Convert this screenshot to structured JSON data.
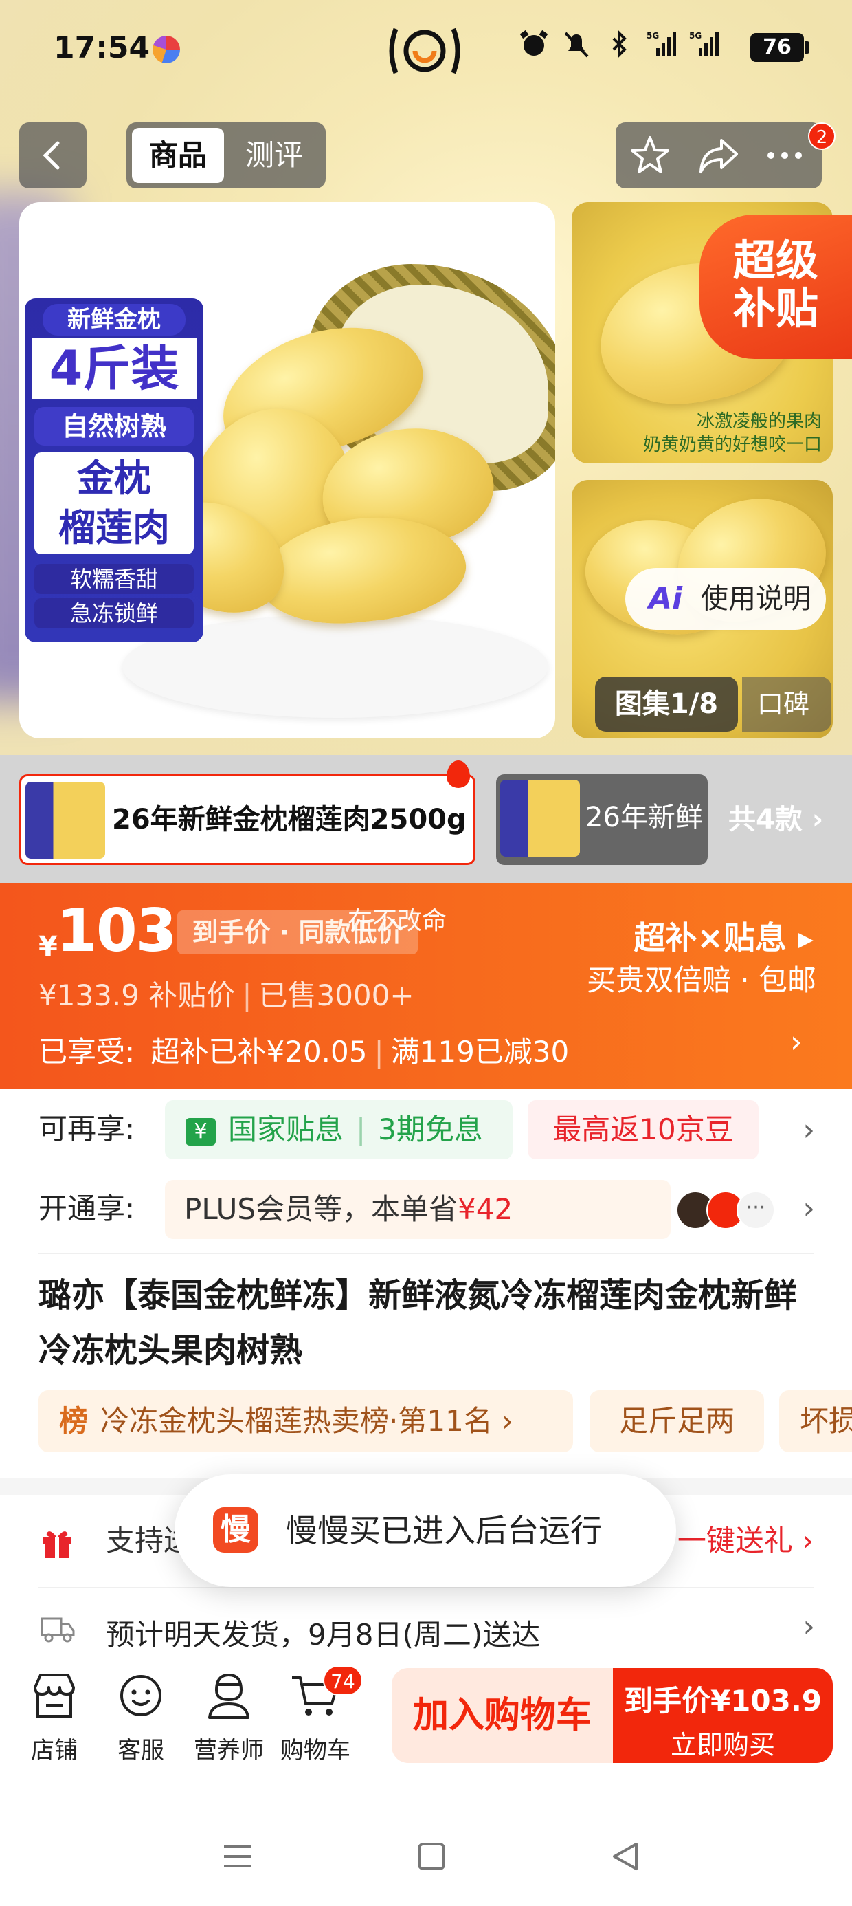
{
  "status_bar": {
    "time": "17:54",
    "battery": "76"
  },
  "header": {
    "tabs": [
      "商品",
      "测评"
    ],
    "message_badge": "2"
  },
  "gallery": {
    "label_card": {
      "top": "新鲜金枕",
      "big": "4斤装",
      "pill": "自然树熟",
      "name": "金枕\n榴莲肉",
      "small1": "软糯香甜",
      "small2": "急冻锁鲜"
    },
    "side_caption_1": "冰激凌般的果肉",
    "side_caption_2": "奶黄奶黄的好想咬一口",
    "subsidy_badge": "超级\n补贴",
    "ai_guide": "使用说明",
    "ai_mark": "Ai",
    "gallery_count": "图集1/8",
    "word_of_mouth": "口碑"
  },
  "variants": {
    "items": [
      "26年新鲜金枕榴莲肉2500g",
      "26年新鲜"
    ],
    "count": "共4款 ›"
  },
  "price": {
    "yen": "¥",
    "integer": "103",
    "decimal": ".9",
    "tag": "到手价 · 同款低价",
    "tip": "在不改命",
    "original": "¥133.9  补贴价",
    "sold": "已售3000+",
    "enjoyed_label": "已享受:",
    "enjoyed_1": "超补已补¥20.05",
    "enjoyed_2": "满119已减30",
    "right_title": "超补×贴息 ▸",
    "right_sub": "买贵双倍赔 · 包邮"
  },
  "promotions": {
    "row1_label": "可再享:",
    "subsidy_icon": "¥",
    "subsidy_text": "国家贴息",
    "installment": "3期免息",
    "jd_beans": "最高返10京豆",
    "row2_label": "开通享:",
    "plus_text": "PLUS会员等，本单省",
    "plus_save": "¥42"
  },
  "product": {
    "title": "璐亦【泰国金枕鲜冻】新鲜液氮冷冻榴莲肉金枕新鲜冷冻枕头果肉树熟",
    "rank_icon": "榜",
    "rank_text": "冷冻金枕头榴莲热卖榜·第11名 ›",
    "tag_full": "足斤足两",
    "tag_bad": "坏损"
  },
  "service": {
    "gift_text": "支持送礼",
    "gift_link": "一键送礼 ›",
    "shipping": "预计明天发货，9月8日(周二)送达"
  },
  "toast": {
    "app_char": "慢",
    "message": "慢慢买已进入后台运行"
  },
  "actions": {
    "store": "店铺",
    "service": "客服",
    "nutritionist": "营养师",
    "cart": "购物车",
    "cart_badge": "74",
    "add_cart": "加入购物车",
    "buy_price": "到手价¥103.9",
    "buy_now": "立即购买"
  },
  "colors": {
    "accent": "#f2270c",
    "price_bar": "#f76a1d",
    "green": "#23a34a"
  }
}
